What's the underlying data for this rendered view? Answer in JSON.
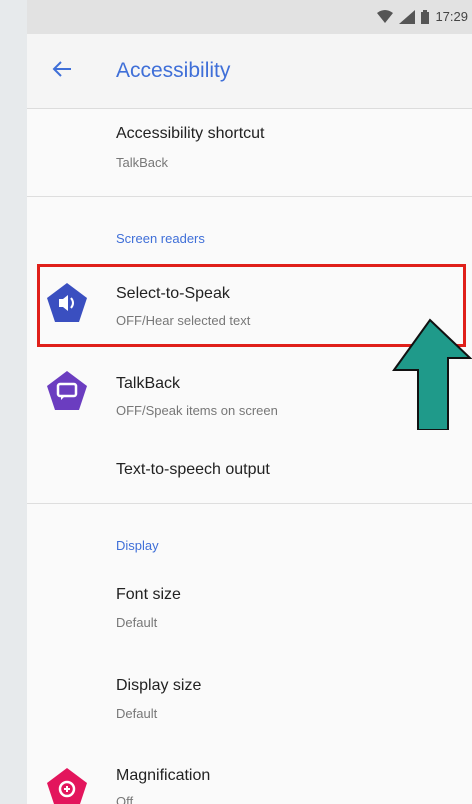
{
  "status": {
    "time": "17:29",
    "wifi_icon": "wifi-icon",
    "signal_icon": "signal-icon",
    "battery_icon": "battery-icon"
  },
  "appbar": {
    "title": "Accessibility",
    "back_icon": "arrow-back-icon"
  },
  "items": {
    "shortcut": {
      "title": "Accessibility shortcut",
      "subtitle": "TalkBack"
    },
    "screen_readers_header": "Screen readers",
    "select_to_speak": {
      "title": "Select-to-Speak",
      "subtitle": "OFF/Hear selected text",
      "icon": "select-to-speak-icon",
      "color": "#3a4fc0"
    },
    "talkback": {
      "title": "TalkBack",
      "subtitle": "OFF/Speak items on screen",
      "icon": "talkback-icon",
      "color": "#6b3dc0"
    },
    "tts": {
      "title": "Text-to-speech output"
    },
    "display_header": "Display",
    "font_size": {
      "title": "Font size",
      "subtitle": "Default"
    },
    "display_size": {
      "title": "Display size",
      "subtitle": "Default"
    },
    "magnification": {
      "title": "Magnification",
      "subtitle": "Off",
      "icon": "magnification-icon",
      "color": "#e3155c"
    }
  },
  "overlay": {
    "highlight_color": "#e0201a",
    "arrow_color": "#1f9a8a"
  }
}
